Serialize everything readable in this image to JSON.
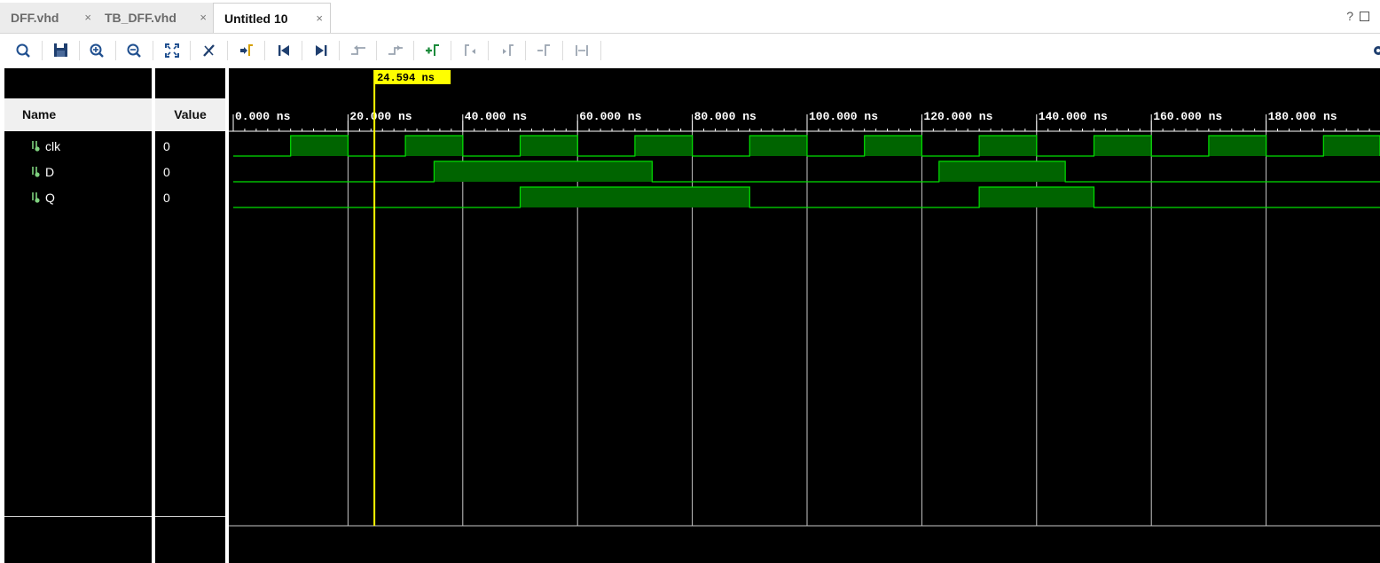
{
  "tabs": [
    {
      "label": "DFF.vhd",
      "close": "×",
      "active": false
    },
    {
      "label": "TB_DFF.vhd",
      "close": "×",
      "active": false
    },
    {
      "label": "Untitled 10",
      "close": "×",
      "active": true
    }
  ],
  "tab_help": "?",
  "toolbar": {
    "icons": [
      "search-icon",
      "save-icon",
      "zoom-in-icon",
      "zoom-out-icon",
      "zoom-fit-icon",
      "cursor-swap-icon",
      "go-to-cursor-icon",
      "go-to-start-icon",
      "go-to-end-icon",
      "previous-transition-icon",
      "next-transition-icon",
      "add-marker-icon",
      "previous-marker-icon",
      "next-marker-icon",
      "swap-cursors-icon",
      "snap-to-transition-icon",
      "settings-gear-icon"
    ]
  },
  "headers": {
    "name": "Name",
    "value": "Value"
  },
  "signals": [
    {
      "name": "clk",
      "value": "0"
    },
    {
      "name": "D",
      "value": "0"
    },
    {
      "name": "Q",
      "value": "0"
    }
  ],
  "cursor": {
    "label": "24.594 ns",
    "time_ns": 24.594
  },
  "timeline": {
    "start_ns": 0,
    "visible_end_ns": 199.6,
    "major_step_ns": 20,
    "minor_step_ns": 2,
    "tick_labels": [
      "0.000 ns",
      "20.000 ns",
      "40.000 ns",
      "60.000 ns",
      "80.000 ns",
      "100.000 ns",
      "120.000 ns",
      "140.000 ns",
      "160.000 ns",
      "180.000 ns"
    ]
  },
  "waveforms": [
    {
      "name": "clk",
      "initial": 0,
      "transitions_ns": [
        10,
        20,
        30,
        40,
        50,
        60,
        70,
        80,
        90,
        100,
        110,
        120,
        130,
        140,
        150,
        160,
        170,
        180,
        190,
        200
      ]
    },
    {
      "name": "D",
      "initial": 0,
      "transitions_ns": [
        35,
        73,
        123,
        145
      ]
    },
    {
      "name": "Q",
      "initial": 0,
      "transitions_ns": [
        50,
        90,
        130,
        150
      ]
    }
  ],
  "colors": {
    "wave": "#00e000",
    "wave_fill": "#006400",
    "cursor": "#ffff00",
    "grid": "#c8c8c8",
    "background": "#000000"
  }
}
